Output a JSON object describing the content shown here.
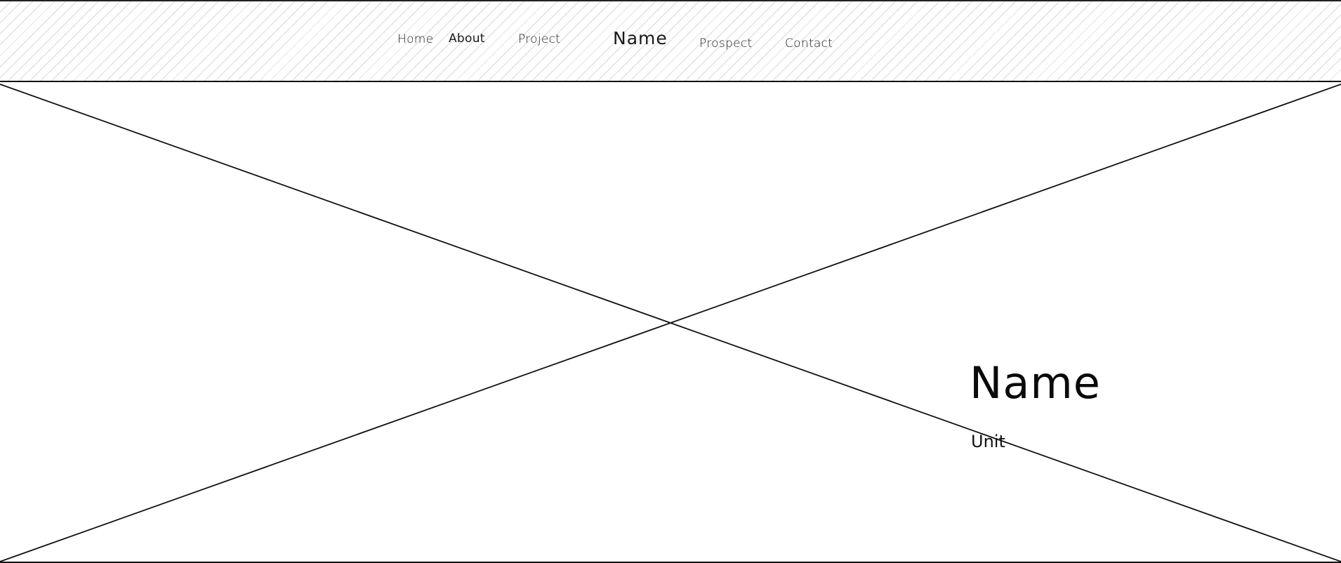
{
  "nav": {
    "home": "Home",
    "about": "About",
    "project": "Project",
    "brand": "Name",
    "prospect": "Prospect",
    "contact": "Contact"
  },
  "hero": {
    "image_placeholder": "image-placeholder-x",
    "title": "Name",
    "subtitle": "Unit"
  },
  "colors": {
    "line": "#111111",
    "hatch": "#d9d9d9",
    "background": "#ffffff"
  }
}
